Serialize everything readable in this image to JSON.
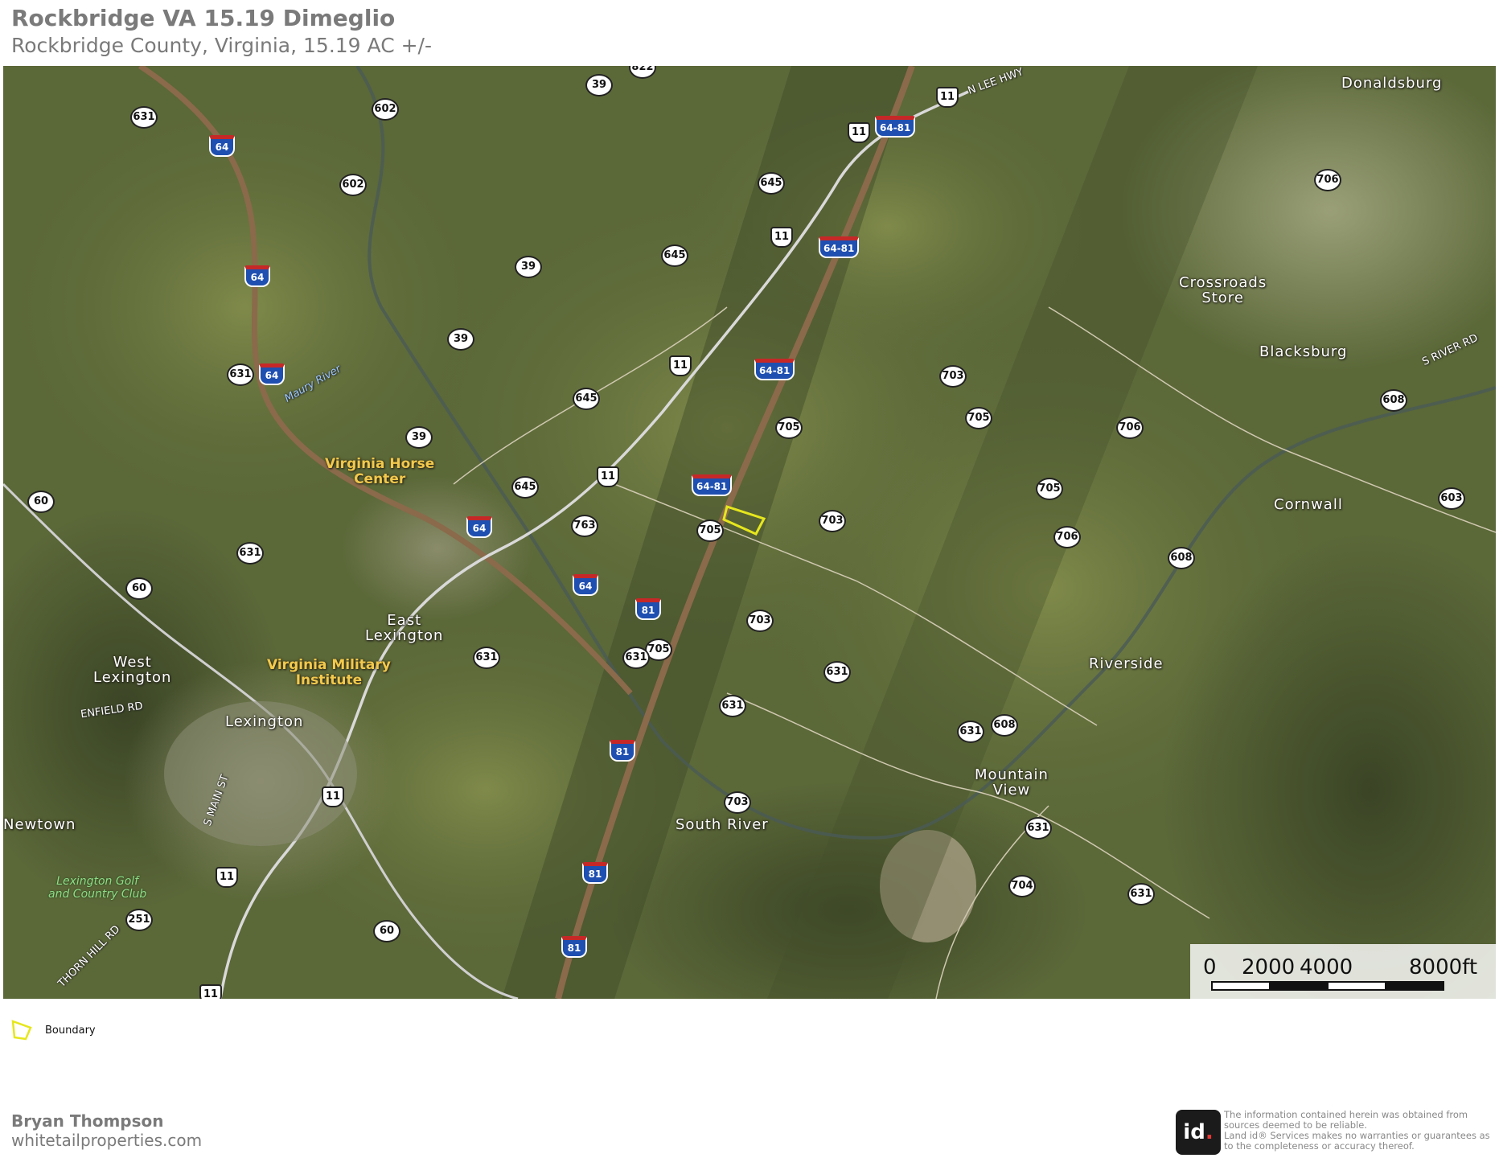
{
  "header": {
    "title": "Rockbridge VA 15.19 Dimeglio",
    "subtitle": "Rockbridge County, Virginia, 15.19 AC +/-"
  },
  "map": {
    "places": [
      "Donaldsburg",
      "Crossroads\nStore",
      "Blacksburg",
      "Cornwall",
      "Riverside",
      "Mountain\nView",
      "South River",
      "East\nLexington",
      "West\nLexington",
      "Lexington",
      "Newtown"
    ],
    "points_of_interest": [
      "Virginia Horse\nCenter",
      "Virginia Military\nInstitute",
      "Lexington Golf\nand Country Club"
    ],
    "water_label": "Maury River",
    "road_names": [
      "N LEE HWY",
      "S RIVER RD",
      "ENFIELD RD",
      "S MAIN ST",
      "THORN HILL RD"
    ],
    "route_shields": [
      "822",
      "39",
      "602",
      "631",
      "602",
      "39",
      "39",
      "645",
      "645",
      "645",
      "645",
      "631",
      "39",
      "631",
      "60",
      "60",
      "631",
      "631",
      "763",
      "705",
      "705",
      "705",
      "703",
      "703",
      "703",
      "703",
      "705",
      "705",
      "706",
      "706",
      "706",
      "608",
      "608",
      "608",
      "603",
      "631",
      "631",
      "631",
      "631",
      "631",
      "704",
      "251",
      "60"
    ],
    "us_shields": [
      "11",
      "11",
      "11",
      "11",
      "11",
      "11",
      "11",
      "11"
    ],
    "interstate_shields": [
      "64",
      "64",
      "64",
      "64",
      "64",
      "64-81",
      "64-81",
      "64-81",
      "64-81",
      "81",
      "81",
      "81",
      "81"
    ],
    "scale_bar": {
      "labels": [
        "0",
        "2000",
        "4000",
        "8000ft"
      ]
    },
    "boundary_color": "#e6e61e"
  },
  "legend": {
    "label": "Boundary"
  },
  "footer": {
    "agent": "Bryan Thompson",
    "website": "whitetailproperties.com",
    "logo_text": "id",
    "logo_dot": ".",
    "disclaimer": "The information contained herein was obtained from sources deemed to be reliable.\n  Land id® Services makes no warranties or guarantees as to the completeness or accuracy thereof."
  }
}
